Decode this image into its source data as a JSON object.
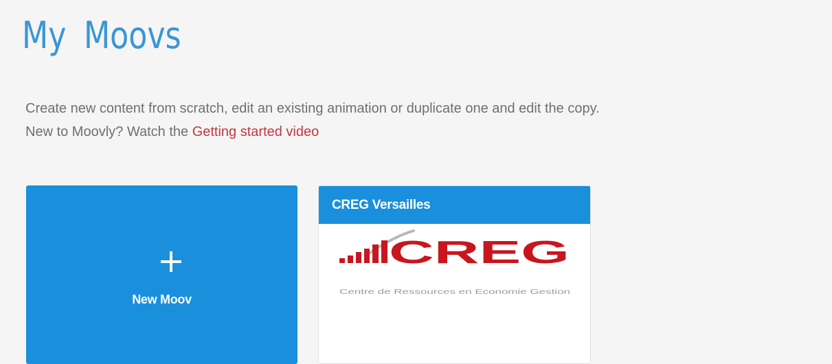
{
  "header": {
    "title": "My  Moovs"
  },
  "intro": {
    "line1": "Create new content from scratch, edit an existing animation or duplicate one and edit the copy.",
    "line2_prefix": "New to Moovly? Watch the ",
    "link_label": "Getting started video"
  },
  "new_moov": {
    "label": "New Moov",
    "icon": "plus-icon"
  },
  "moovs": [
    {
      "title": "CREG Versailles",
      "thumbnail": {
        "logo_text": "CREG",
        "logo_subtitle": "Centre de Ressources en Economie Gestion"
      }
    }
  ],
  "colors": {
    "accent": "#1a8fdc",
    "title": "#3a96d6",
    "link": "#c2383f",
    "text": "#6f6f6f",
    "background": "#f5f5f5",
    "logo_red": "#c8161e"
  }
}
